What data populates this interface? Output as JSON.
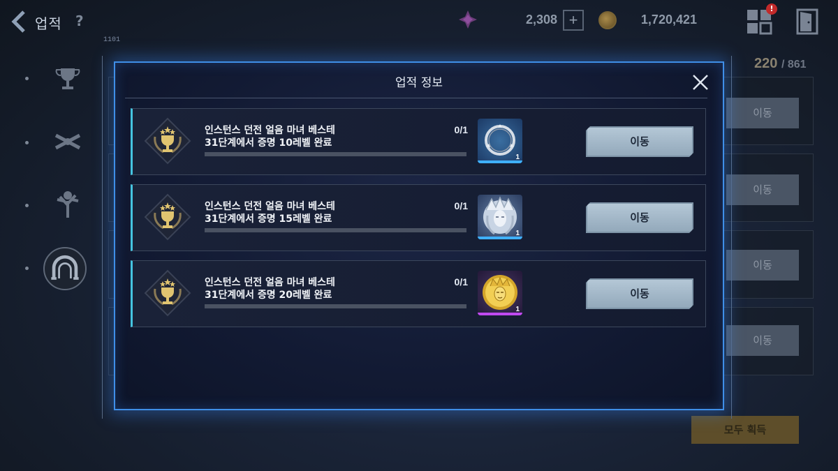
{
  "topbar": {
    "title": "업적",
    "help": "?",
    "gem_count": "2,308",
    "plus": "+",
    "coin_count": "1,720,421",
    "notification_badge": "!"
  },
  "background": {
    "label": "1101",
    "count_current": "220",
    "count_total": "/ 861",
    "move_labels": [
      "이동",
      "이동",
      "이동",
      "이동"
    ],
    "claim_all": "모두 획득"
  },
  "modal": {
    "title": "업적 정보",
    "achievements": [
      {
        "line1": "인스턴스 던전 얼음 마녀 베스테",
        "line2": "31단계에서 증명 10레벨 완료",
        "progress": "0/1",
        "progress_fraction": 0,
        "reward_icon": "silver-ring-icon",
        "reward_qty": "1",
        "reward_rarity_color": "#3fb0ff",
        "button": "이동"
      },
      {
        "line1": "인스턴스 던전 얼음 마녀 베스테",
        "line2": "31단계에서 증명 15레벨 완료",
        "progress": "0/1",
        "progress_fraction": 0,
        "reward_icon": "ice-witch-portrait-icon",
        "reward_qty": "1",
        "reward_rarity_color": "#3fb0ff",
        "button": "이동"
      },
      {
        "line1": "인스턴스 던전 얼음 마녀 베스테",
        "line2": "31단계에서 증명 20레벨 완료",
        "progress": "0/1",
        "progress_fraction": 0,
        "reward_icon": "golden-witch-coin-icon",
        "reward_qty": "1",
        "reward_rarity_color": "#c04af0",
        "button": "이동"
      }
    ]
  },
  "colors": {
    "modal_border": "#3f8fe8",
    "row_accent": "#45c4e0",
    "button_bg": "#a5b9c9"
  }
}
